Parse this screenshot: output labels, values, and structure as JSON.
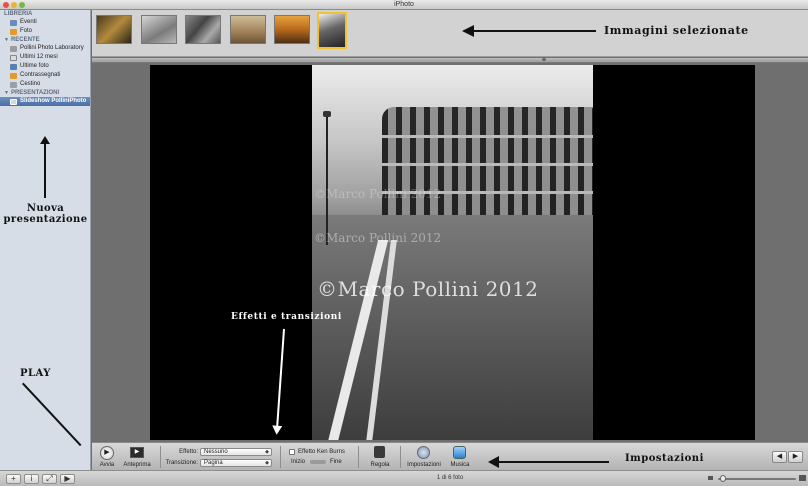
{
  "window": {
    "title": "iPhoto"
  },
  "sidebar": {
    "libreria": {
      "header": "LIBRERIA",
      "items": [
        {
          "label": "Eventi"
        },
        {
          "label": "Foto"
        }
      ]
    },
    "recente": {
      "header": "RECENTE",
      "items": [
        {
          "label": "Pollini Photo Laboratory"
        },
        {
          "label": "Ultimi 12 mesi"
        },
        {
          "label": "Ultime foto"
        },
        {
          "label": "Contrassegnati"
        },
        {
          "label": "Cestino"
        }
      ]
    },
    "presentazioni": {
      "header": "PRESENTAZIONI",
      "items": [
        {
          "label": "Slideshow PolliniPhoto",
          "selected": true
        }
      ]
    }
  },
  "annotations": {
    "immagini": "Immagini selezionate",
    "nuova_line1": "Nuova",
    "nuova_line2": "presentazione",
    "effetti": "Effetti e transizioni",
    "play": "PLAY",
    "impostazioni": "Impostazioni"
  },
  "slide": {
    "watermark": "©Marco Pollini 2012"
  },
  "toolbar": {
    "play_label": "Avvia",
    "preview_label": "Anteprima",
    "effect_label": "Effetto:",
    "effect_value": "Nessuno",
    "transition_label": "Transizione:",
    "transition_value": "Pagina",
    "kenburns_label": "Effetto Ken Burns",
    "start_label": "Inizio",
    "end_label": "Fine",
    "regola_label": "Regola",
    "impostazioni_label": "Impostazioni",
    "musica_label": "Musica"
  },
  "statusbar": {
    "photo_count": "1 di 6 foto"
  },
  "thumbnails": {
    "count": 6,
    "selected_index": 5
  },
  "colors": {
    "selection_border": "#f1c232",
    "sidebar_bg": "#d6dde7",
    "canvas_bg": "#6f6f6f"
  }
}
